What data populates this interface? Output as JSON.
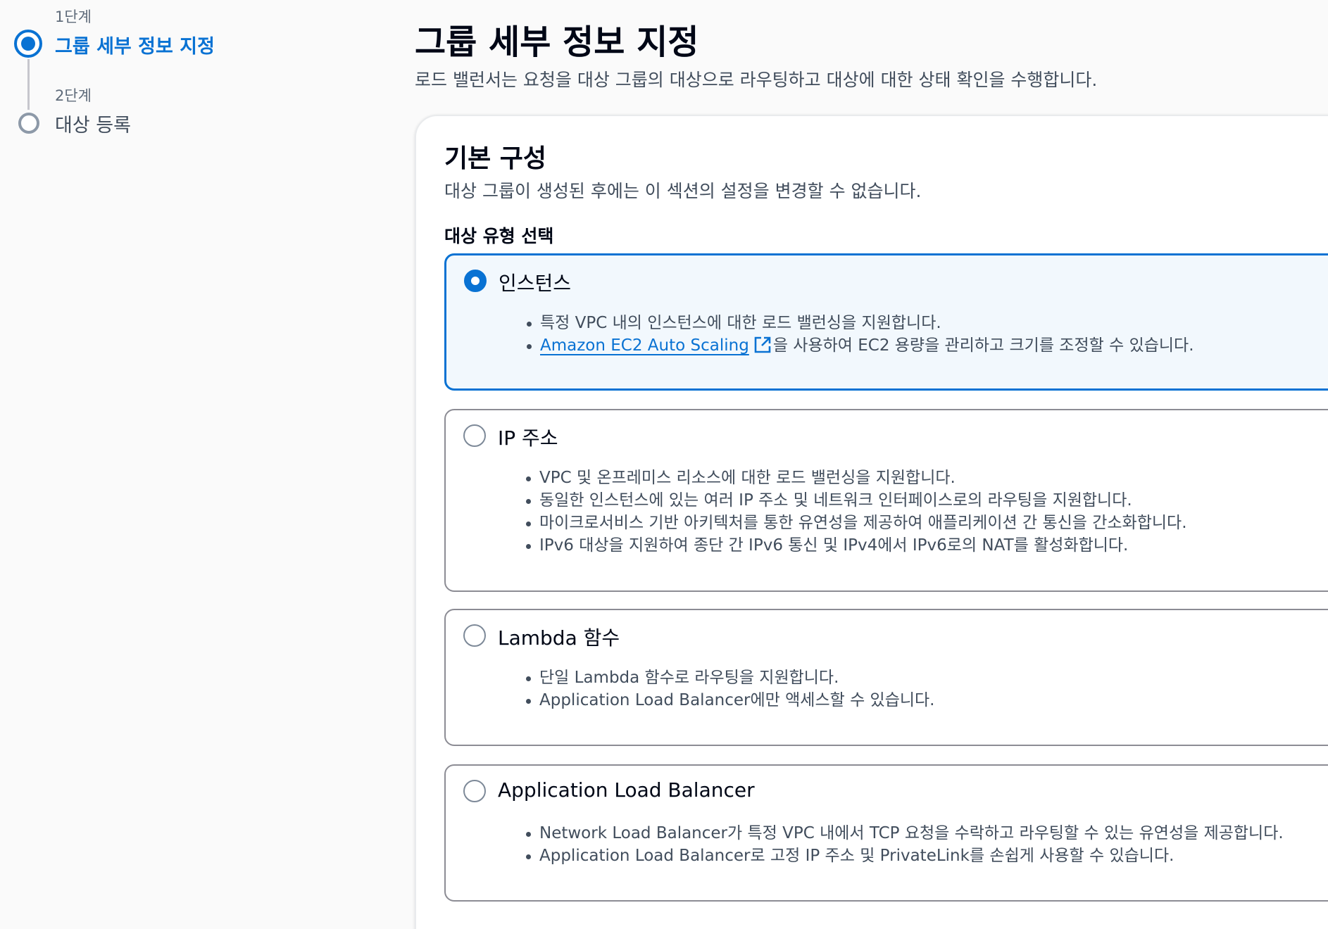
{
  "wizard": {
    "steps": [
      {
        "caption": "1단계",
        "title": "그룹 세부 정보 지정",
        "state": "active"
      },
      {
        "caption": "2단계",
        "title": "대상 등록",
        "state": "inactive"
      }
    ]
  },
  "header": {
    "title": "그룹 세부 정보 지정",
    "description": "로드 밸런서는 요청을 대상 그룹의 대상으로 라우팅하고 대상에 대한 상태 확인을 수행합니다."
  },
  "basic_config": {
    "title": "기본 구성",
    "description": "대상 그룹이 생성된 후에는 이 섹션의 설정을 변경할 수 없습니다.",
    "target_type_label": "대상 유형 선택",
    "options": [
      {
        "title": "인스턴스",
        "selected": true,
        "bullets": [
          "특정 VPC 내의 인스턴스에 대한 로드 밸런싱을 지원합니다.",
          "을 사용하여 EC2 용량을 관리하고 크기를 조정할 수 있습니다."
        ],
        "link_text": "Amazon EC2 Auto Scaling"
      },
      {
        "title": "IP 주소",
        "selected": false,
        "bullets": [
          "VPC 및 온프레미스 리소스에 대한 로드 밸런싱을 지원합니다.",
          "동일한 인스턴스에 있는 여러 IP 주소 및 네트워크 인터페이스로의 라우팅을 지원합니다.",
          "마이크로서비스 기반 아키텍처를 통한 유연성을 제공하여 애플리케이션 간 통신을 간소화합니다.",
          "IPv6 대상을 지원하여 종단 간 IPv6 통신 및 IPv4에서 IPv6로의 NAT를 활성화합니다."
        ]
      },
      {
        "title": "Lambda 함수",
        "selected": false,
        "bullets": [
          "단일 Lambda 함수로 라우팅을 지원합니다.",
          "Application Load Balancer에만 액세스할 수 있습니다."
        ]
      },
      {
        "title": "Application Load Balancer",
        "selected": false,
        "bullets": [
          "Network Load Balancer가 특정 VPC 내에서 TCP 요청을 수락하고 라우팅할 수 있는 유연성을 제공합니다.",
          "Application Load Balancer로 고정 IP 주소 및 PrivateLink를 손쉽게 사용할 수 있습니다."
        ]
      }
    ]
  },
  "icons": {
    "external_link": "external-link-icon",
    "step_active": "step-active-icon",
    "step_inactive": "step-inactive-icon"
  },
  "colors": {
    "accent": "#0972d3",
    "selected_tile_bg": "#f2f8fd",
    "text_secondary": "#414d5c"
  }
}
